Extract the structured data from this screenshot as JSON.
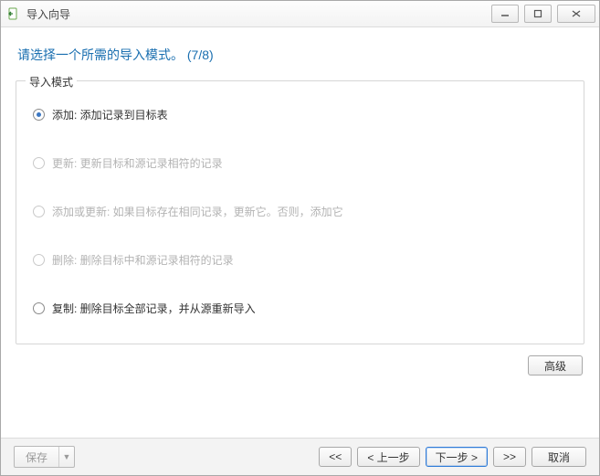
{
  "window": {
    "title": "导入向导"
  },
  "heading": "请选择一个所需的导入模式。 (7/8)",
  "group": {
    "legend": "导入模式",
    "options": {
      "add": {
        "label": "添加: 添加记录到目标表",
        "checked": true,
        "enabled": true
      },
      "update": {
        "label": "更新: 更新目标和源记录相符的记录",
        "checked": false,
        "enabled": false
      },
      "upsert": {
        "label": "添加或更新: 如果目标存在相同记录，更新它。否则，添加它",
        "checked": false,
        "enabled": false
      },
      "delete": {
        "label": "删除: 删除目标中和源记录相符的记录",
        "checked": false,
        "enabled": false
      },
      "copy": {
        "label": "复制: 删除目标全部记录，并从源重新导入",
        "checked": false,
        "enabled": true
      }
    }
  },
  "buttons": {
    "advanced": "高级",
    "save": "保存",
    "first": "<<",
    "back": "< 上一步",
    "next": "下一步 >",
    "last": ">>",
    "cancel": "取消"
  }
}
